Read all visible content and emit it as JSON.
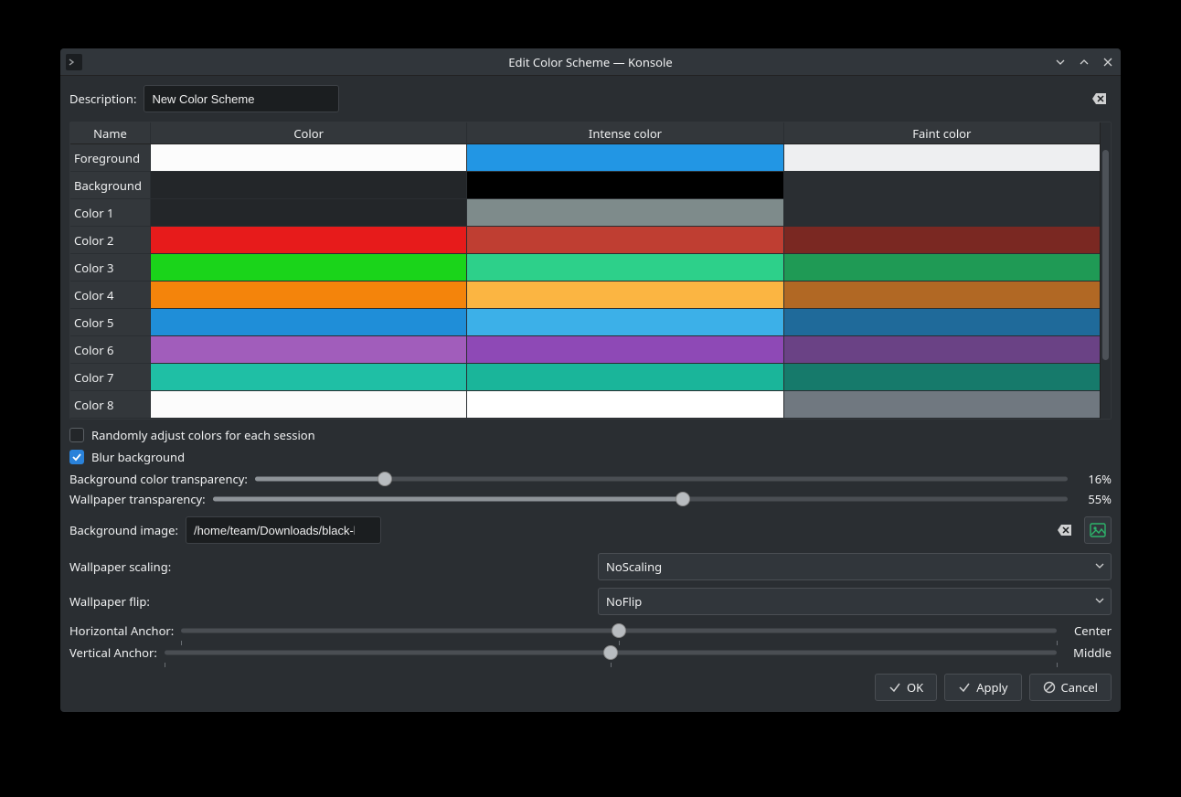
{
  "title": "Edit Color Scheme — Konsole",
  "labels": {
    "description": "Description:",
    "random": "Randomly adjust colors for each session",
    "blur": "Blur background",
    "bgtrans": "Background color transparency:",
    "walltrans": "Wallpaper transparency:",
    "bgimage": "Background image:",
    "wallscale": "Wallpaper scaling:",
    "wallflip": "Wallpaper flip:",
    "horiz": "Horizontal Anchor:",
    "vert": "Vertical Anchor:"
  },
  "description_value": "New Color Scheme",
  "headers": {
    "name": "Name",
    "color": "Color",
    "intense": "Intense color",
    "faint": "Faint color"
  },
  "rows": [
    {
      "name": "Foreground",
      "c": "#fcfcfc",
      "i": "#2296e4",
      "f": "#eeeff1"
    },
    {
      "name": "Background",
      "c": "#232629",
      "i": "#000000",
      "f": "#2a2e32"
    },
    {
      "name": "Color 1",
      "c": "#232629",
      "i": "#7e8b8b",
      "f": "#2a2e32"
    },
    {
      "name": "Color 2",
      "c": "#e71b1b",
      "i": "#bf3e32",
      "f": "#7a2822"
    },
    {
      "name": "Color 3",
      "c": "#1ad41a",
      "i": "#2dd08a",
      "f": "#1f9a55"
    },
    {
      "name": "Color 4",
      "c": "#f4840b",
      "i": "#fbb542",
      "f": "#b16824"
    },
    {
      "name": "Color 5",
      "c": "#1f8ed8",
      "i": "#3cb0e8",
      "f": "#1f6a9a"
    },
    {
      "name": "Color 6",
      "c": "#a15dbb",
      "i": "#8e49b6",
      "f": "#6a4285"
    },
    {
      "name": "Color 7",
      "c": "#1fbfa5",
      "i": "#1ab59a",
      "f": "#167a6b"
    },
    {
      "name": "Color 8",
      "c": "#fcfcfc",
      "i": "#ffffff",
      "f": "#707880"
    }
  ],
  "random_checked": false,
  "blur_checked": true,
  "bgtrans_pct": 16,
  "walltrans_pct": 55,
  "pct": {
    "bg": "16%",
    "wall": "55%"
  },
  "bgimage_value": "/home/team/Downloads/black-hole.jpg",
  "wallscale_value": "NoScaling",
  "wallflip_value": "NoFlip",
  "horiz_pct": 50,
  "vert_pct": 50,
  "anchor": {
    "horiz": "Center",
    "vert": "Middle"
  },
  "buttons": {
    "ok": "OK",
    "apply": "Apply",
    "cancel": "Cancel"
  }
}
